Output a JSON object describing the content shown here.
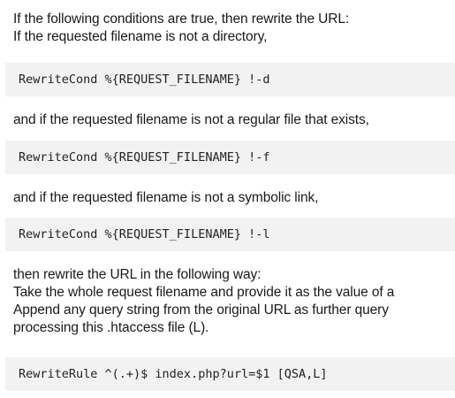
{
  "intro": {
    "line1": "If the following conditions are true, then rewrite the URL:",
    "line2": "If the requested filename is not a directory,"
  },
  "code1": "RewriteCond %{REQUEST_FILENAME} !-d",
  "text2": "and if the requested filename is not a regular file that exists,",
  "code2": "RewriteCond %{REQUEST_FILENAME} !-f",
  "text3": "and if the requested filename is not a symbolic link,",
  "code3": "RewriteCond %{REQUEST_FILENAME} !-l",
  "outro": {
    "line1": "then rewrite the URL in the following way:",
    "line2": "Take the whole request filename and provide it as the value of a",
    "line3": "Append any query string from the original URL as further query",
    "line4": "processing this .htaccess file (L)."
  },
  "code4": "RewriteRule ^(.+)$ index.php?url=$1 [QSA,L]"
}
